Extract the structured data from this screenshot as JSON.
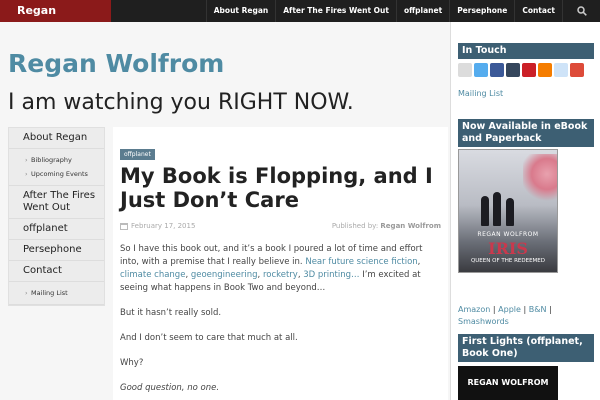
{
  "site": {
    "brand": "Regan Wolfrom",
    "title": "Regan Wolfrom",
    "tagline": "I am watching you RIGHT NOW."
  },
  "topnav": [
    "About Regan",
    "After The Fires Went Out",
    "offplanet",
    "Persephone",
    "Contact"
  ],
  "sidenav": {
    "about": "About Regan",
    "bibliography": "Bibliography",
    "upcoming": "Upcoming Events",
    "fires": "After The Fires Went Out",
    "offplanet": "offplanet",
    "persephone": "Persephone",
    "contact": "Contact",
    "mailing": "Mailing List"
  },
  "post": {
    "category": "offplanet",
    "title": "My Book is Flopping, and I Just Don’t Care",
    "date": "February 17, 2015",
    "published_by_label": "Published by:",
    "author": "Regan Wolfrom",
    "p1_start": "So I have this book out, and it’s a book I poured a lot of time and effort into, with a premise that I really believe in.",
    "link1": "Near future science fiction",
    "link2": "climate change",
    "link3": "geoengineering",
    "link4": "rocketry",
    "link5": "3D printing…",
    "p1_end": "I’m excited at seeing what happens in Book Two and beyond…",
    "p2": "But it hasn’t really sold.",
    "p3": "And I don’t seem to care that much at all.",
    "p4": "Why?",
    "p5": "Good question, no one."
  },
  "sidebar": {
    "intouch_title": "In Touch",
    "social_icons": [
      "mail-icon",
      "twitter-icon",
      "facebook-icon",
      "tumblr-icon",
      "pinterest-icon",
      "blogger-icon",
      "reddit-icon",
      "google-plus-icon"
    ],
    "social_colors": [
      "#dcdcdc",
      "#55acee",
      "#3b5998",
      "#35465c",
      "#cb2027",
      "#f57d00",
      "#cee3f8",
      "#dd4b39"
    ],
    "mailing_list": "Mailing List",
    "ebook_title": "Now Available in eBook and Paperback",
    "cover_author": "REGAN WOLFROM",
    "cover_title": "IRIS",
    "cover_subtitle": "QUEEN OF THE REDEEMED",
    "buy_amazon": "Amazon",
    "buy_apple": "Apple",
    "buy_bn": "B&N",
    "buy_smashwords": "Smashwords",
    "firstlights_title": "First Lights (offplanet, Book One)",
    "cover2_author": "REGAN WOLFROM"
  },
  "colors": {
    "brand_bg": "#8b1a1a",
    "accent": "#4f8ba3",
    "widget_title_bg": "#3d5f73"
  }
}
